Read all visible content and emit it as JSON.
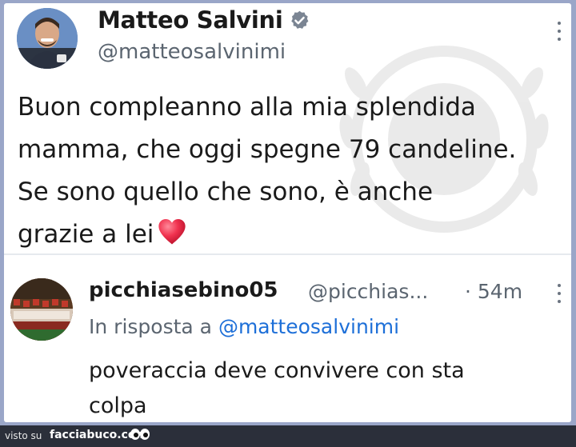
{
  "tweet": {
    "author_name": "Matteo Salvini",
    "author_handle": "@matteosalvinimi",
    "text_line1": "Buon compleanno alla mia splendida",
    "text_line2": "mamma, che oggi spegne 79 candeline.",
    "text_line3": "Se sono quello che sono, è anche",
    "text_line4": "grazie a lei",
    "verified": true,
    "icons": [
      "verified-badge-icon",
      "heart-emoji-icon",
      "more-options-icon"
    ]
  },
  "reply": {
    "author_name": "picchiasebino05",
    "author_handle": "@picchias...",
    "time": "· 54m",
    "replying_to_prefix": "In risposta a",
    "replying_to_handle": "@matteosalvinimi",
    "text_line1": "poveraccia deve convivere con sta",
    "text_line2": "colpa"
  },
  "footer": {
    "visto_su": "visto su",
    "site": "facciabuco.com"
  },
  "colors": {
    "frame": "#9aa6c8",
    "card": "#ffffff",
    "mention": "#1d6fd8",
    "secondary_text": "#5b6570",
    "heart": "#e8334a"
  }
}
